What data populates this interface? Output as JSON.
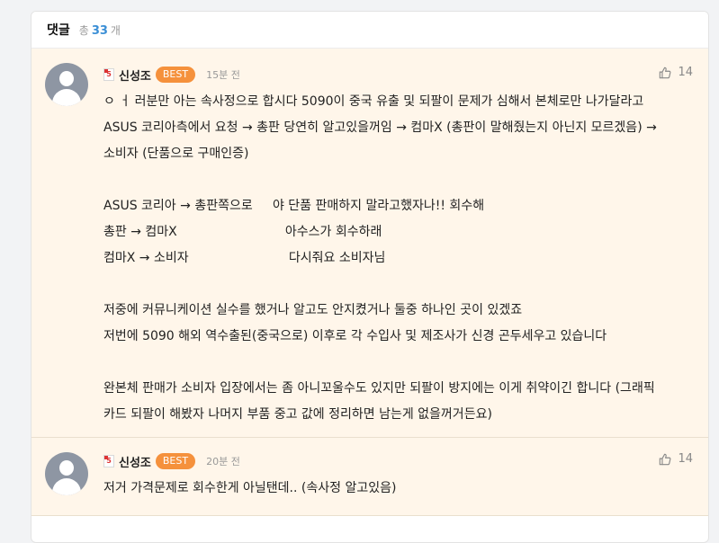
{
  "header": {
    "title": "댓글",
    "count_prefix": "총",
    "count": "33",
    "count_suffix": "개"
  },
  "comments": [
    {
      "level": "5",
      "author": "신성조",
      "badge": "BEST",
      "time": "15분 전",
      "likes": "14",
      "lines": [
        "ㅇ ㅓ 러분만 아는 속사정으로 합시다 5090이 중국 유출 및 되팔이 문제가 심해서 본체로만 나가달라고",
        "ASUS 코리아측에서 요청 → 총판 당연히 알고있을꺼임 → 컴마X (총판이 말해줬는지 아닌지 모르겠음) →",
        "소비자 (단품으로 구매인증)",
        "",
        "ASUS 코리아 → 총판쪽으로     야 단품 판매하지 말라고했자나!! 회수해",
        "총판 → 컴마X                           아수스가 회수하래",
        "컴마X → 소비자                         다시줘요 소비자님",
        "",
        "저중에 커뮤니케이션 실수를 했거나 알고도 안지켰거나 둘중 하나인 곳이 있겠죠",
        "저번에 5090 해외 역수출된(중국으로) 이후로 각 수입사 및 제조사가 신경 곤두세우고 있습니다",
        "",
        "완본체 판매가 소비자 입장에서는 좀 아니꼬울수도 있지만 되팔이 방지에는 이게 취약이긴 합니다 (그래픽",
        "카드 되팔이 해봤자 나머지 부품 중고 값에 정리하면 남는게 없을꺼거든요)"
      ]
    },
    {
      "level": "5",
      "author": "신성조",
      "badge": "BEST",
      "time": "20분 전",
      "likes": "14",
      "lines": [
        "저거 가격문제로 회수한게 아닐탠데.. (속사정 알고있음)"
      ]
    }
  ],
  "colors": {
    "best_badge": "#f5913c",
    "count": "#3b8fd6",
    "comment_bg": "#fff6ea"
  },
  "icons": {
    "like": "thumbs-up-icon",
    "avatar": "default-user-avatar-icon",
    "level": "level-badge-icon"
  }
}
